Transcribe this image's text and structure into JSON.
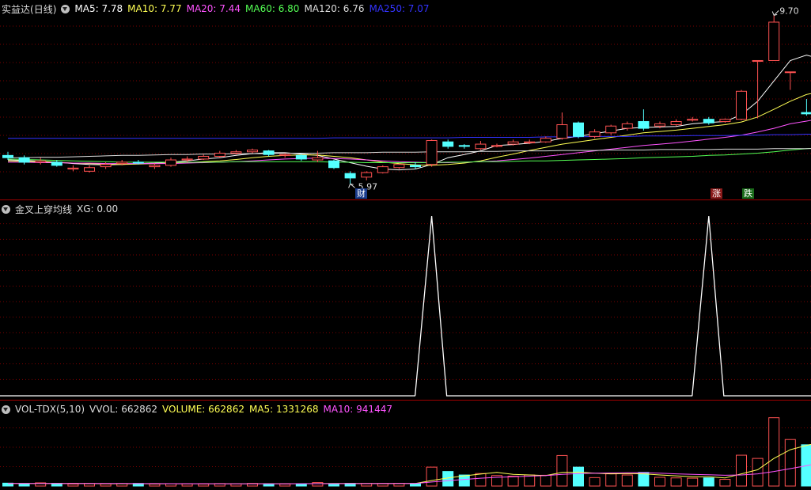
{
  "stock": {
    "name": "实益达",
    "period": "(日线)"
  },
  "main_panel": {
    "indicators": [
      {
        "label": "MA5: 7.78",
        "color": "#ffffff"
      },
      {
        "label": "MA10: 7.77",
        "color": "#ffff54"
      },
      {
        "label": "MA20: 7.44",
        "color": "#ff54ff"
      },
      {
        "label": "MA60: 6.80",
        "color": "#54ff54"
      },
      {
        "label": "MA120: 6.76",
        "color": "#dddddd"
      },
      {
        "label": "MA250: 7.07",
        "color": "#3333ff"
      }
    ],
    "high_label": "9.70",
    "low_label": "5.97",
    "event_tag_cai": "财",
    "event_tag_zhang": "涨",
    "event_tag_die": "跌"
  },
  "signal_panel": {
    "title": "金叉上穿均线",
    "xg_label": "XG: 0.00"
  },
  "volume_panel": {
    "title": "VOL-TDX(5,10)",
    "indicators": [
      {
        "label": "VVOL: 662862",
        "color": "#dddddd"
      },
      {
        "label": "VOLUME: 662862",
        "color": "#ffff54"
      },
      {
        "label": "MA5: 1331268",
        "color": "#ffff54"
      },
      {
        "label": "MA10: 941447",
        "color": "#ff54ff"
      }
    ]
  },
  "colors": {
    "up": "#ff5252",
    "down": "#54ffff",
    "grid": "#7a0000",
    "separator": "#a00000"
  },
  "chart_data": {
    "type": "candlestick",
    "price_ylim": [
      5.8,
      9.9
    ],
    "candles": [
      [
        6.6,
        6.55,
        6.68,
        6.5
      ],
      [
        6.55,
        6.45,
        6.6,
        6.4
      ],
      [
        6.45,
        6.48,
        6.55,
        6.4
      ],
      [
        6.45,
        6.38,
        6.5,
        6.35
      ],
      [
        6.3,
        6.32,
        6.38,
        6.25
      ],
      [
        6.25,
        6.33,
        6.38,
        6.22
      ],
      [
        6.35,
        6.4,
        6.45,
        6.3
      ],
      [
        6.42,
        6.45,
        6.5,
        6.38
      ],
      [
        6.45,
        6.43,
        6.5,
        6.4
      ],
      [
        6.35,
        6.38,
        6.42,
        6.3
      ],
      [
        6.38,
        6.5,
        6.55,
        6.35
      ],
      [
        6.5,
        6.52,
        6.58,
        6.45
      ],
      [
        6.52,
        6.58,
        6.62,
        6.5
      ],
      [
        6.58,
        6.65,
        6.7,
        6.55
      ],
      [
        6.65,
        6.68,
        6.72,
        6.62
      ],
      [
        6.68,
        6.72,
        6.75,
        6.65
      ],
      [
        6.7,
        6.62,
        6.72,
        6.58
      ],
      [
        6.6,
        6.62,
        6.65,
        6.55
      ],
      [
        6.6,
        6.52,
        6.63,
        6.48
      ],
      [
        6.5,
        6.55,
        6.7,
        6.45
      ],
      [
        6.48,
        6.33,
        6.5,
        6.3
      ],
      [
        6.2,
        6.1,
        6.25,
        5.97
      ],
      [
        6.12,
        6.22,
        6.25,
        6.05
      ],
      [
        6.22,
        6.35,
        6.38,
        6.2
      ],
      [
        6.33,
        6.4,
        6.42,
        6.3
      ],
      [
        6.38,
        6.35,
        6.45,
        6.3
      ],
      [
        6.4,
        6.93,
        6.95,
        6.35
      ],
      [
        6.9,
        6.8,
        6.95,
        6.75
      ],
      [
        6.82,
        6.8,
        6.85,
        6.75
      ],
      [
        6.75,
        6.85,
        6.92,
        6.72
      ],
      [
        6.8,
        6.82,
        6.86,
        6.78
      ],
      [
        6.85,
        6.9,
        6.95,
        6.82
      ],
      [
        6.88,
        6.9,
        6.95,
        6.85
      ],
      [
        6.9,
        6.98,
        7.02,
        6.88
      ],
      [
        6.98,
        7.28,
        7.55,
        6.95
      ],
      [
        7.32,
        7.02,
        7.35,
        6.98
      ],
      [
        7.02,
        7.12,
        7.18,
        6.98
      ],
      [
        7.1,
        7.25,
        7.28,
        7.05
      ],
      [
        7.2,
        7.3,
        7.35,
        7.15
      ],
      [
        7.35,
        7.2,
        7.62,
        7.15
      ],
      [
        7.25,
        7.3,
        7.35,
        7.2
      ],
      [
        7.28,
        7.35,
        7.4,
        7.25
      ],
      [
        7.38,
        7.4,
        7.45,
        7.35
      ],
      [
        7.4,
        7.32,
        7.45,
        7.28
      ],
      [
        7.35,
        7.4,
        7.42,
        7.32
      ],
      [
        7.4,
        8.02,
        8.05,
        7.38
      ],
      [
        8.7,
        8.7,
        8.7,
        7.42
      ],
      [
        8.7,
        9.55,
        9.7,
        8.7
      ],
      [
        8.45,
        8.45,
        8.45,
        8.05
      ],
      [
        7.55,
        7.52,
        7.85,
        7.48
      ],
      [
        7.4,
        7.35,
        7.52,
        7.3
      ],
      [
        7.25,
        7.15,
        7.3,
        7.05
      ]
    ],
    "ma_series": [
      {
        "name": "MA5",
        "values": [
          6.5,
          6.49,
          6.47,
          6.45,
          6.42,
          6.4,
          6.39,
          6.4,
          6.42,
          6.43,
          6.45,
          6.48,
          6.52,
          6.55,
          6.6,
          6.64,
          6.66,
          6.66,
          6.63,
          6.6,
          6.52,
          6.44,
          6.36,
          6.3,
          6.28,
          6.3,
          6.4,
          6.55,
          6.62,
          6.7,
          6.82,
          6.84,
          6.87,
          6.91,
          6.98,
          7.02,
          7.08,
          7.14,
          7.2,
          7.22,
          7.23,
          7.24,
          7.3,
          7.33,
          7.35,
          7.5,
          7.8,
          8.25,
          8.7,
          8.82,
          8.72,
          8.46
        ]
      },
      {
        "name": "MA10",
        "values": [
          6.48,
          6.47,
          6.46,
          6.45,
          6.43,
          6.42,
          6.41,
          6.4,
          6.41,
          6.42,
          6.43,
          6.44,
          6.46,
          6.48,
          6.51,
          6.55,
          6.58,
          6.6,
          6.61,
          6.61,
          6.58,
          6.55,
          6.5,
          6.45,
          6.42,
          6.39,
          6.38,
          6.4,
          6.43,
          6.48,
          6.56,
          6.63,
          6.71,
          6.78,
          6.85,
          6.9,
          6.95,
          7.0,
          7.05,
          7.1,
          7.13,
          7.16,
          7.2,
          7.24,
          7.28,
          7.34,
          7.45,
          7.62,
          7.8,
          7.95,
          8.02,
          8.01
        ]
      },
      {
        "name": "MA20",
        "values": [
          6.45,
          6.45,
          6.44,
          6.44,
          6.43,
          6.43,
          6.42,
          6.42,
          6.42,
          6.42,
          6.42,
          6.43,
          6.44,
          6.45,
          6.46,
          6.48,
          6.5,
          6.52,
          6.53,
          6.54,
          6.53,
          6.52,
          6.5,
          6.48,
          6.46,
          6.45,
          6.44,
          6.44,
          6.45,
          6.46,
          6.48,
          6.51,
          6.54,
          6.58,
          6.62,
          6.66,
          6.7,
          6.74,
          6.78,
          6.82,
          6.85,
          6.88,
          6.92,
          6.96,
          7.0,
          7.05,
          7.12,
          7.2,
          7.3,
          7.36,
          7.42,
          7.44
        ]
      },
      {
        "name": "MA60",
        "values": [
          6.52,
          6.51,
          6.5,
          6.49,
          6.48,
          6.47,
          6.46,
          6.45,
          6.45,
          6.45,
          6.45,
          6.45,
          6.45,
          6.45,
          6.46,
          6.46,
          6.46,
          6.46,
          6.46,
          6.46,
          6.45,
          6.45,
          6.44,
          6.44,
          6.44,
          6.44,
          6.44,
          6.45,
          6.45,
          6.46,
          6.46,
          6.47,
          6.48,
          6.48,
          6.49,
          6.5,
          6.51,
          6.52,
          6.53,
          6.55,
          6.56,
          6.57,
          6.58,
          6.6,
          6.61,
          6.63,
          6.65,
          6.68,
          6.72,
          6.75,
          6.78,
          6.8
        ]
      },
      {
        "name": "MA120",
        "values": [
          6.55,
          6.55,
          6.56,
          6.56,
          6.57,
          6.58,
          6.59,
          6.6,
          6.6,
          6.61,
          6.62,
          6.62,
          6.63,
          6.63,
          6.64,
          6.64,
          6.64,
          6.65,
          6.65,
          6.65,
          6.66,
          6.66,
          6.66,
          6.67,
          6.67,
          6.67,
          6.68,
          6.68,
          6.68,
          6.69,
          6.69,
          6.7,
          6.7,
          6.7,
          6.71,
          6.71,
          6.71,
          6.72,
          6.72,
          6.72,
          6.73,
          6.73,
          6.73,
          6.73,
          6.74,
          6.74,
          6.74,
          6.75,
          6.75,
          6.75,
          6.76,
          6.76
        ]
      },
      {
        "name": "MA250",
        "values": [
          6.98,
          6.98,
          6.98,
          6.98,
          6.98,
          6.98,
          6.98,
          6.98,
          6.98,
          6.98,
          6.98,
          6.98,
          6.98,
          6.98,
          6.98,
          6.98,
          6.98,
          6.98,
          6.98,
          6.98,
          6.99,
          6.99,
          6.99,
          6.99,
          6.99,
          6.99,
          6.99,
          6.99,
          7.0,
          7.0,
          7.0,
          7.0,
          7.0,
          7.01,
          7.01,
          7.01,
          7.02,
          7.02,
          7.02,
          7.03,
          7.03,
          7.03,
          7.04,
          7.04,
          7.04,
          7.05,
          7.05,
          7.06,
          7.06,
          7.07,
          7.07,
          7.07
        ]
      }
    ],
    "xg_signal": [
      0,
      0,
      0,
      0,
      0,
      0,
      0,
      0,
      0,
      0,
      0,
      0,
      0,
      0,
      0,
      0,
      0,
      0,
      0,
      0,
      0,
      0,
      0,
      0,
      0,
      0,
      1,
      0,
      0,
      0,
      0,
      0,
      0,
      0,
      0,
      0,
      0,
      0,
      0,
      0,
      0,
      0,
      0,
      1,
      0,
      0,
      0,
      0,
      0,
      0,
      0,
      0
    ],
    "volume": [
      100,
      80,
      110,
      90,
      70,
      80,
      75,
      85,
      90,
      70,
      80,
      75,
      70,
      85,
      80,
      90,
      80,
      70,
      80,
      120,
      80,
      90,
      85,
      80,
      90,
      80,
      650,
      500,
      380,
      430,
      360,
      340,
      380,
      370,
      1050,
      650,
      290,
      420,
      380,
      470,
      300,
      280,
      270,
      280,
      230,
      1060,
      950,
      2350,
      1600,
      1420,
      800,
      663
    ],
    "volume_ma5": [
      90,
      90,
      88,
      90,
      88,
      86,
      83,
      80,
      82,
      80,
      78,
      80,
      79,
      78,
      78,
      80,
      81,
      80,
      82,
      85,
      86,
      88,
      87,
      90,
      88,
      86,
      190,
      280,
      350,
      410,
      470,
      400,
      380,
      360,
      470,
      480,
      440,
      420,
      430,
      420,
      380,
      350,
      320,
      320,
      280,
      420,
      560,
      950,
      1250,
      1400,
      1520,
      1331
    ],
    "volume_ma10": [
      92,
      91,
      90,
      90,
      89,
      88,
      87,
      86,
      85,
      84,
      83,
      82,
      81,
      80,
      80,
      80,
      80,
      80,
      81,
      82,
      83,
      84,
      85,
      86,
      87,
      88,
      140,
      185,
      230,
      270,
      300,
      320,
      340,
      360,
      400,
      430,
      440,
      450,
      455,
      460,
      440,
      420,
      400,
      390,
      370,
      380,
      420,
      500,
      600,
      700,
      820,
      941
    ]
  }
}
